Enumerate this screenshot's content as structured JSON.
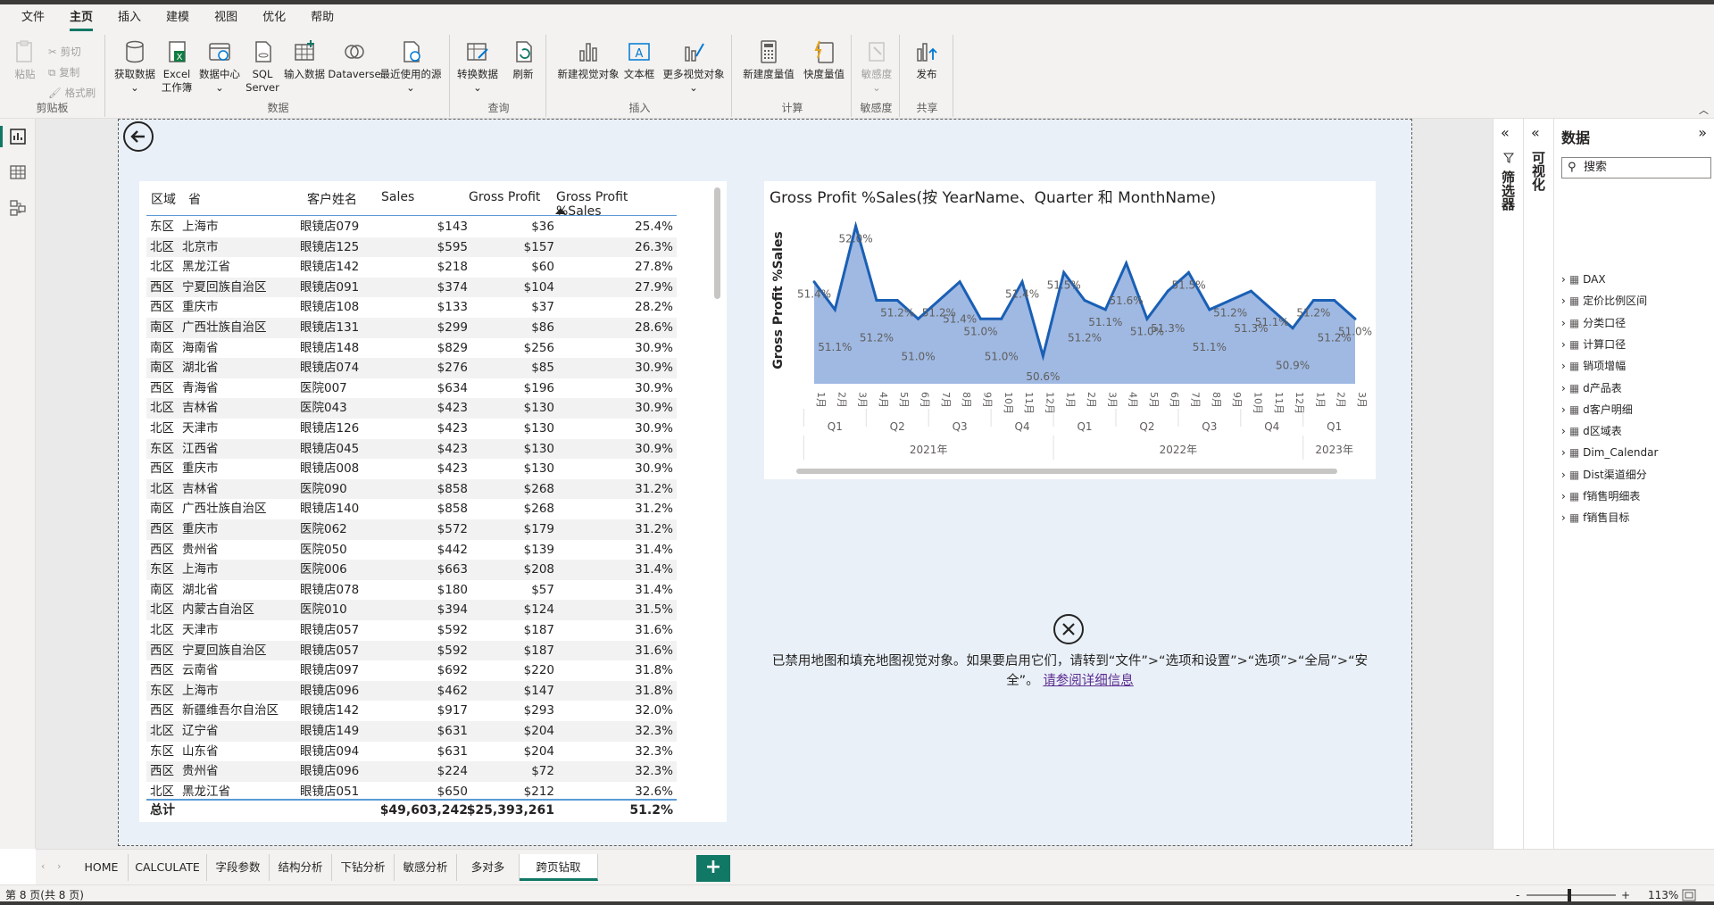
{
  "menu": [
    "文件",
    "主页",
    "插入",
    "建模",
    "视图",
    "优化",
    "帮助"
  ],
  "ribbon": {
    "clipboard": {
      "paste": "粘贴",
      "cut": "剪切",
      "copy": "复制",
      "format": "格式刷",
      "label": "剪贴板"
    },
    "data": {
      "get": "获取数据",
      "excel": "Excel 工作簿",
      "hub": "数据中心",
      "sql": "SQL Server",
      "enter": "输入数据",
      "dataverse": "Dataverse",
      "recent": "最近使用的源",
      "label": "数据"
    },
    "query": {
      "transform": "转换数据",
      "refresh": "刷新",
      "label": "查询"
    },
    "insert": {
      "newvisual": "新建视觉对象",
      "textbox": "文本框",
      "more": "更多视觉对象",
      "label": "插入"
    },
    "calc": {
      "measure": "新建度量值",
      "quick": "快度量值",
      "label": "计算"
    },
    "sens": {
      "sens": "敏感度",
      "label": "敏感度"
    },
    "share": {
      "publish": "发布",
      "label": "共享"
    }
  },
  "table": {
    "headers": [
      "区域",
      "省",
      "客户姓名",
      "Sales",
      "Gross Profit",
      "Gross Profit %Sales"
    ],
    "rows": [
      [
        "东区",
        "上海市",
        "眼镜店079",
        "$143",
        "$36",
        "25.4%"
      ],
      [
        "北区",
        "北京市",
        "眼镜店125",
        "$595",
        "$157",
        "26.3%"
      ],
      [
        "北区",
        "黑龙江省",
        "眼镜店142",
        "$218",
        "$60",
        "27.8%"
      ],
      [
        "西区",
        "宁夏回族自治区",
        "眼镜店091",
        "$374",
        "$104",
        "27.9%"
      ],
      [
        "西区",
        "重庆市",
        "眼镜店108",
        "$133",
        "$37",
        "28.2%"
      ],
      [
        "南区",
        "广西壮族自治区",
        "眼镜店131",
        "$299",
        "$86",
        "28.6%"
      ],
      [
        "南区",
        "海南省",
        "眼镜店148",
        "$829",
        "$256",
        "30.9%"
      ],
      [
        "南区",
        "湖北省",
        "眼镜店074",
        "$276",
        "$85",
        "30.9%"
      ],
      [
        "西区",
        "青海省",
        "医院007",
        "$634",
        "$196",
        "30.9%"
      ],
      [
        "北区",
        "吉林省",
        "医院043",
        "$423",
        "$130",
        "30.9%"
      ],
      [
        "北区",
        "天津市",
        "眼镜店126",
        "$423",
        "$130",
        "30.9%"
      ],
      [
        "东区",
        "江西省",
        "眼镜店045",
        "$423",
        "$130",
        "30.9%"
      ],
      [
        "西区",
        "重庆市",
        "眼镜店008",
        "$423",
        "$130",
        "30.9%"
      ],
      [
        "北区",
        "吉林省",
        "医院090",
        "$858",
        "$268",
        "31.2%"
      ],
      [
        "南区",
        "广西壮族自治区",
        "眼镜店140",
        "$858",
        "$268",
        "31.2%"
      ],
      [
        "西区",
        "重庆市",
        "医院062",
        "$572",
        "$179",
        "31.2%"
      ],
      [
        "西区",
        "贵州省",
        "医院050",
        "$442",
        "$139",
        "31.4%"
      ],
      [
        "东区",
        "上海市",
        "医院006",
        "$663",
        "$208",
        "31.4%"
      ],
      [
        "南区",
        "湖北省",
        "眼镜店078",
        "$180",
        "$57",
        "31.4%"
      ],
      [
        "北区",
        "内蒙古自治区",
        "医院010",
        "$394",
        "$124",
        "31.5%"
      ],
      [
        "北区",
        "天津市",
        "眼镜店057",
        "$592",
        "$187",
        "31.6%"
      ],
      [
        "西区",
        "宁夏回族自治区",
        "眼镜店057",
        "$592",
        "$187",
        "31.6%"
      ],
      [
        "西区",
        "云南省",
        "眼镜店097",
        "$692",
        "$220",
        "31.8%"
      ],
      [
        "东区",
        "上海市",
        "眼镜店096",
        "$462",
        "$147",
        "31.8%"
      ],
      [
        "西区",
        "新疆维吾尔自治区",
        "眼镜店142",
        "$917",
        "$293",
        "32.0%"
      ],
      [
        "北区",
        "辽宁省",
        "眼镜店149",
        "$631",
        "$204",
        "32.3%"
      ],
      [
        "东区",
        "山东省",
        "眼镜店094",
        "$631",
        "$204",
        "32.3%"
      ],
      [
        "西区",
        "贵州省",
        "眼镜店096",
        "$224",
        "$72",
        "32.3%"
      ],
      [
        "北区",
        "黑龙江省",
        "眼镜店051",
        "$650",
        "$212",
        "32.6%"
      ]
    ],
    "total": {
      "label": "总计",
      "sales": "$49,603,242",
      "gp": "$25,393,261",
      "pct": "51.2%"
    }
  },
  "chart_data": {
    "type": "area",
    "title": "Gross Profit %Sales(按 YearName、Quarter 和 MonthName)",
    "ylabel": "Gross Profit %Sales",
    "x": [
      "1月",
      "2月",
      "3月",
      "4月",
      "5月",
      "6月",
      "7月",
      "8月",
      "9月",
      "10月",
      "11月",
      "12月",
      "1月",
      "2月",
      "3月",
      "4月",
      "5月",
      "6月",
      "7月",
      "8月",
      "9月",
      "10月",
      "11月",
      "12月",
      "1月",
      "2月",
      "3月"
    ],
    "values": [
      51.4,
      51.1,
      52.0,
      51.2,
      51.2,
      51.0,
      51.2,
      51.4,
      51.0,
      51.0,
      51.4,
      50.6,
      51.5,
      51.2,
      51.1,
      51.6,
      51.0,
      51.3,
      51.5,
      51.1,
      51.2,
      51.3,
      51.1,
      50.9,
      51.2,
      51.2,
      51.0
    ],
    "labels": [
      "51.4%",
      "51.1%",
      "52.0%",
      "51.2%",
      "51.2%",
      "51.0%",
      "51.2%",
      "51.4%",
      "51.0%",
      "51.0%",
      "51.4%",
      "50.6%",
      "51.5%",
      "51.2%",
      "51.1%",
      "51.6%",
      "51.0%",
      "51.3%",
      "51.5%",
      "51.1%",
      "51.2%",
      "51.3%",
      "51.1%",
      "50.9%",
      "51.2%",
      "51.2%",
      "51.0%"
    ],
    "quarters": [
      "Q1",
      "Q2",
      "Q3",
      "Q4",
      "Q1",
      "Q2",
      "Q3",
      "Q4",
      "Q1"
    ],
    "years": [
      "2021年",
      "2022年",
      "2023年"
    ],
    "ylim": [
      50.3,
      52.1
    ],
    "colors": {
      "line": "#1a5fb4",
      "fill": "#9fb9e3"
    }
  },
  "map_message": {
    "text": "已禁用地图和填充地图视觉对象。如果要启用它们，请转到“文件”>“选项和设置”>“选项”>“全局”>“安全”。",
    "link": "请参阅详细信息"
  },
  "panes": {
    "filter": "筛选器",
    "viz": "可视化",
    "data_title": "数据",
    "search_placeholder": "搜索"
  },
  "fields": [
    "DAX",
    "定价比例区间",
    "分类口径",
    "计算口径",
    "销项增幅",
    "d产品表",
    "d客户明细",
    "d区域表",
    "Dim_Calendar",
    "Dist渠道细分",
    "f销售明细表",
    "f销售目标"
  ],
  "tabs": [
    "HOME",
    "CALCULATE",
    "字段参数",
    "结构分析",
    "下钻分析",
    "敏感分析",
    "多对多",
    "跨页钻取"
  ],
  "status": {
    "page": "第 8 页(共 8 页)",
    "zoom": "113%"
  }
}
